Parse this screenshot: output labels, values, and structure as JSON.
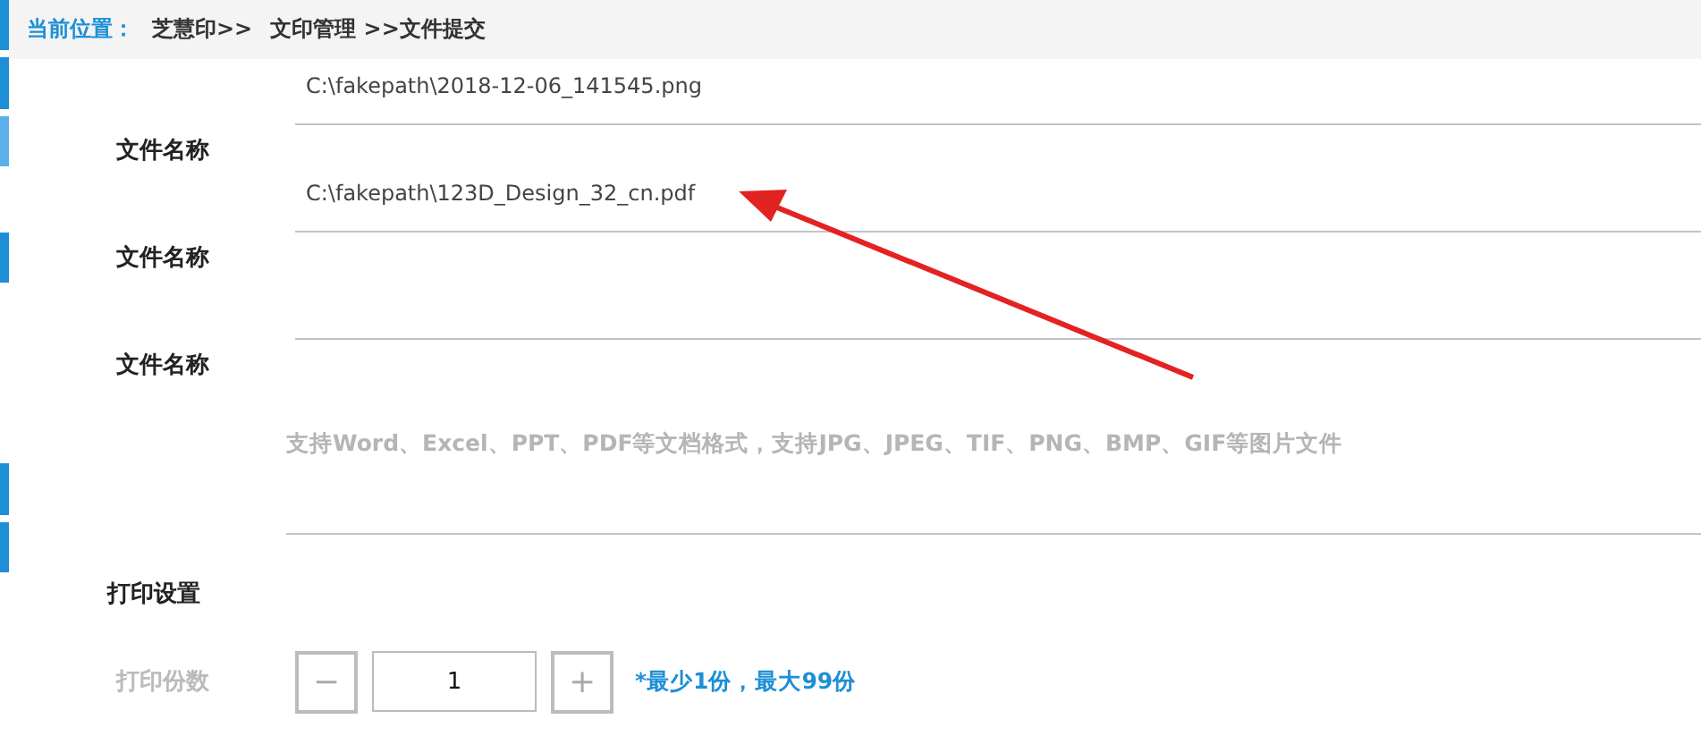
{
  "breadcrumb": {
    "label": "当前位置：",
    "items": [
      "芝慧印>>",
      "文印管理 >>文件提交"
    ]
  },
  "file_fields": [
    {
      "label": "文件名称",
      "value": "C:\\fakepath\\2018-12-06_141545.png"
    },
    {
      "label": "文件名称",
      "value": "C:\\fakepath\\123D_Design_32_cn.pdf"
    },
    {
      "label": "文件名称"
    }
  ],
  "format_hint": "支持Word、Excel、PPT、PDF等文档格式，支持JPG、JPEG、TIF、PNG、BMP、GIF等图片文件",
  "print_settings": {
    "title": "打印设置",
    "copies_label": "打印份数",
    "decrement": "−",
    "copies": "1",
    "increment": "+",
    "limit_note": "*最少1份，最大99份"
  }
}
